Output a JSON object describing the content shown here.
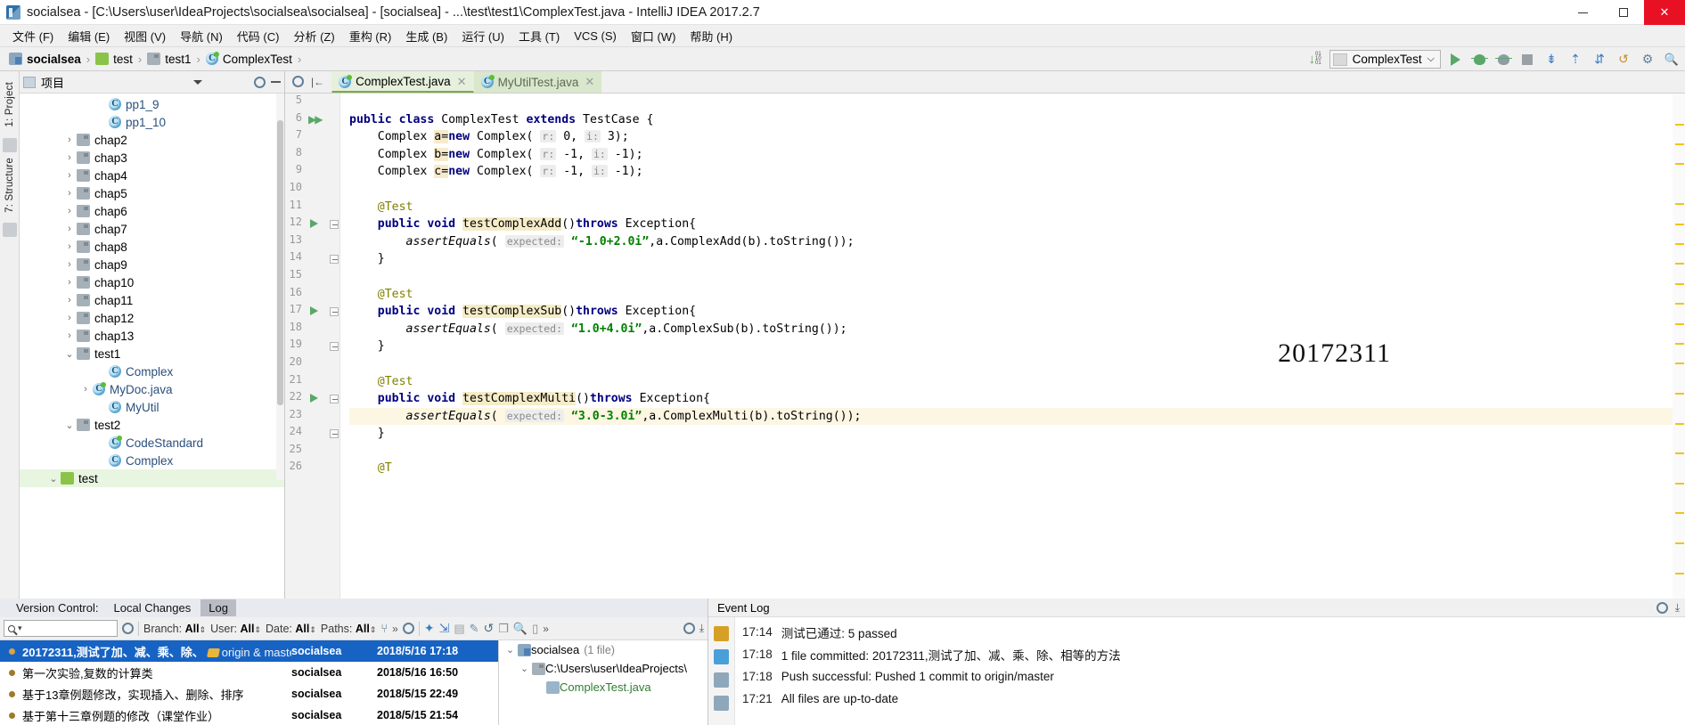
{
  "window": {
    "title": "socialsea - [C:\\Users\\user\\IdeaProjects\\socialsea\\socialsea] - [socialsea] - ...\\test\\test1\\ComplexTest.java - IntelliJ IDEA 2017.2.7",
    "app_icon": "intellij-idea-icon",
    "controls": {
      "minimize": "—",
      "maximize": "☐",
      "close": "✕"
    }
  },
  "menubar": {
    "items": [
      "文件 (F)",
      "编辑 (E)",
      "视图 (V)",
      "导航 (N)",
      "代码 (C)",
      "分析 (Z)",
      "重构 (R)",
      "生成 (B)",
      "运行 (U)",
      "工具 (T)",
      "VCS (S)",
      "窗口 (W)",
      "帮助 (H)"
    ]
  },
  "navbar": {
    "breadcrumbs": [
      {
        "label": "socialsea",
        "icon": "module-icon"
      },
      {
        "label": "test",
        "icon": "folder-green-icon"
      },
      {
        "label": "test1",
        "icon": "folder-gray-icon"
      },
      {
        "label": "ComplexTest",
        "icon": "java-class-icon"
      }
    ],
    "separator": "›",
    "run_config": {
      "name": "ComplexTest",
      "dropdown": "⌵"
    },
    "update_badge": "01\n10\n01",
    "buttons": [
      "run-button",
      "debug-button",
      "run-coverage-button",
      "stop-button",
      "vcs-update-button",
      "vcs-commit-button",
      "vcs-compare-button",
      "undo-button",
      "settings-button",
      "search-everywhere-button"
    ]
  },
  "left_rail": {
    "tabs": [
      "1: Project",
      "7: Structure"
    ],
    "bottom_icon": "favorites-icon"
  },
  "project_panel": {
    "title": "项目",
    "toolbar": [
      "collapse-all-icon",
      "settings-gear-icon",
      "hide-icon"
    ],
    "tree": [
      {
        "label": "pp1_9",
        "indent": 4,
        "arrow": "",
        "icon": "java-class-icon",
        "type": "class"
      },
      {
        "label": "pp1_10",
        "indent": 4,
        "arrow": "",
        "icon": "java-class-icon",
        "type": "class"
      },
      {
        "label": "chap2",
        "indent": 2,
        "arrow": "›",
        "icon": "folder-gray-icon",
        "type": "folder"
      },
      {
        "label": "chap3",
        "indent": 2,
        "arrow": "›",
        "icon": "folder-gray-icon",
        "type": "folder"
      },
      {
        "label": "chap4",
        "indent": 2,
        "arrow": "›",
        "icon": "folder-gray-icon",
        "type": "folder"
      },
      {
        "label": "chap5",
        "indent": 2,
        "arrow": "›",
        "icon": "folder-gray-icon",
        "type": "folder"
      },
      {
        "label": "chap6",
        "indent": 2,
        "arrow": "›",
        "icon": "folder-gray-icon",
        "type": "folder"
      },
      {
        "label": "chap7",
        "indent": 2,
        "arrow": "›",
        "icon": "folder-gray-icon",
        "type": "folder"
      },
      {
        "label": "chap8",
        "indent": 2,
        "arrow": "›",
        "icon": "folder-gray-icon",
        "type": "folder"
      },
      {
        "label": "chap9",
        "indent": 2,
        "arrow": "›",
        "icon": "folder-gray-icon",
        "type": "folder"
      },
      {
        "label": "chap10",
        "indent": 2,
        "arrow": "›",
        "icon": "folder-gray-icon",
        "type": "folder"
      },
      {
        "label": "chap11",
        "indent": 2,
        "arrow": "›",
        "icon": "folder-gray-icon",
        "type": "folder"
      },
      {
        "label": "chap12",
        "indent": 2,
        "arrow": "›",
        "icon": "folder-gray-icon",
        "type": "folder"
      },
      {
        "label": "chap13",
        "indent": 2,
        "arrow": "›",
        "icon": "folder-gray-icon",
        "type": "folder"
      },
      {
        "label": "test1",
        "indent": 2,
        "arrow": "⌄",
        "icon": "folder-gray-icon",
        "type": "folder"
      },
      {
        "label": "Complex",
        "indent": 4,
        "arrow": "",
        "icon": "java-class-icon",
        "type": "class"
      },
      {
        "label": "MyDoc.java",
        "indent": 3,
        "arrow": "›",
        "icon": "java-file-icon",
        "type": "class-run"
      },
      {
        "label": "MyUtil",
        "indent": 4,
        "arrow": "",
        "icon": "java-class-icon",
        "type": "class"
      },
      {
        "label": "test2",
        "indent": 2,
        "arrow": "⌄",
        "icon": "folder-gray-icon",
        "type": "folder"
      },
      {
        "label": "CodeStandard",
        "indent": 4,
        "arrow": "",
        "icon": "java-class-icon",
        "type": "class-run"
      },
      {
        "label": "Complex",
        "indent": 4,
        "arrow": "",
        "icon": "java-class-icon",
        "type": "class"
      },
      {
        "label": "test",
        "indent": 1,
        "arrow": "⌄",
        "icon": "folder-green-icon",
        "type": "folder",
        "selected": true
      }
    ]
  },
  "editor": {
    "tabs": [
      {
        "label": "ComplexTest.java",
        "icon": "java-class-icon",
        "active": true,
        "close": "✕"
      },
      {
        "label": "MyUtilTest.java",
        "icon": "java-class-icon",
        "active": false,
        "close": "✕"
      }
    ],
    "watermark": "20172311",
    "breadcrumb": [
      "ComplexTest",
      "testComplexMulti()"
    ],
    "breadcrumb_separator": "›",
    "lines": [
      {
        "num": "5",
        "segments": []
      },
      {
        "num": "6",
        "gutter": "run-all-icon",
        "segments": [
          {
            "t": "public ",
            "c": "kw"
          },
          {
            "t": "class ",
            "c": "kw"
          },
          {
            "t": "ComplexTest "
          },
          {
            "t": "extends ",
            "c": "kw"
          },
          {
            "t": "TestCase {"
          }
        ]
      },
      {
        "num": "7",
        "segments": [
          {
            "t": "    Complex "
          },
          {
            "t": "a",
            "c": "varhl"
          },
          {
            "t": "=",
            "c": "varhl"
          },
          {
            "t": "new",
            "c": "kw"
          },
          {
            "t": " Complex( "
          },
          {
            "t": "r:",
            "c": "hint"
          },
          {
            "t": " 0, "
          },
          {
            "t": "i:",
            "c": "hint"
          },
          {
            "t": " 3);"
          }
        ]
      },
      {
        "num": "8",
        "segments": [
          {
            "t": "    Complex "
          },
          {
            "t": "b",
            "c": "varhl"
          },
          {
            "t": "=",
            "c": "varhl"
          },
          {
            "t": "new",
            "c": "kw"
          },
          {
            "t": " Complex( "
          },
          {
            "t": "r:",
            "c": "hint"
          },
          {
            "t": " -1, "
          },
          {
            "t": "i:",
            "c": "hint"
          },
          {
            "t": " -1);"
          }
        ]
      },
      {
        "num": "9",
        "segments": [
          {
            "t": "    Complex "
          },
          {
            "t": "c",
            "c": "varhl"
          },
          {
            "t": "=",
            "c": "varhl"
          },
          {
            "t": "new",
            "c": "kw"
          },
          {
            "t": " Complex( "
          },
          {
            "t": "r:",
            "c": "hint"
          },
          {
            "t": " -1, "
          },
          {
            "t": "i:",
            "c": "hint"
          },
          {
            "t": " -1);"
          }
        ]
      },
      {
        "num": "10",
        "segments": []
      },
      {
        "num": "11",
        "segments": [
          {
            "t": "    @Test",
            "c": "anno"
          }
        ]
      },
      {
        "num": "12",
        "gutter": "run-method-icon",
        "fold": true,
        "segments": [
          {
            "t": "    public ",
            "c": "kw"
          },
          {
            "t": "void ",
            "c": "kw"
          },
          {
            "t": "testComplexAdd",
            "c": "mname"
          },
          {
            "t": "()"
          },
          {
            "t": "throws ",
            "c": "kw"
          },
          {
            "t": "Exception{"
          }
        ]
      },
      {
        "num": "13",
        "segments": [
          {
            "t": "        assertEquals",
            "c": "ital"
          },
          {
            "t": "( "
          },
          {
            "t": "expected:",
            "c": "hint"
          },
          {
            "t": " "
          },
          {
            "t": "“-1.0+2.0i”",
            "c": "str"
          },
          {
            "t": ",a.ComplexAdd(b).toString());"
          }
        ]
      },
      {
        "num": "14",
        "fold": true,
        "segments": [
          {
            "t": "    }"
          }
        ]
      },
      {
        "num": "15",
        "segments": []
      },
      {
        "num": "16",
        "segments": [
          {
            "t": "    @Test",
            "c": "anno"
          }
        ]
      },
      {
        "num": "17",
        "gutter": "run-method-icon",
        "fold": true,
        "segments": [
          {
            "t": "    public ",
            "c": "kw"
          },
          {
            "t": "void ",
            "c": "kw"
          },
          {
            "t": "testComplexSub",
            "c": "mname"
          },
          {
            "t": "()"
          },
          {
            "t": "throws ",
            "c": "kw"
          },
          {
            "t": "Exception{"
          }
        ]
      },
      {
        "num": "18",
        "segments": [
          {
            "t": "        assertEquals",
            "c": "ital"
          },
          {
            "t": "( "
          },
          {
            "t": "expected:",
            "c": "hint"
          },
          {
            "t": " "
          },
          {
            "t": "“1.0+4.0i”",
            "c": "str"
          },
          {
            "t": ",a.ComplexSub(b).toString());"
          }
        ]
      },
      {
        "num": "19",
        "fold": true,
        "segments": [
          {
            "t": "    }"
          }
        ]
      },
      {
        "num": "20",
        "segments": []
      },
      {
        "num": "21",
        "segments": [
          {
            "t": "    @Test",
            "c": "anno"
          }
        ]
      },
      {
        "num": "22",
        "gutter": "run-method-icon",
        "fold": true,
        "segments": [
          {
            "t": "    public ",
            "c": "kw"
          },
          {
            "t": "void ",
            "c": "kw"
          },
          {
            "t": "testComplexMulti",
            "c": "mname"
          },
          {
            "t": "()"
          },
          {
            "t": "throws ",
            "c": "kw"
          },
          {
            "t": "Exception{"
          }
        ]
      },
      {
        "num": "23",
        "highlight": true,
        "segments": [
          {
            "t": "        assertEquals",
            "c": "ital"
          },
          {
            "t": "( "
          },
          {
            "t": "expected:",
            "c": "hint"
          },
          {
            "t": " "
          },
          {
            "t": "“3.0-3.0i”",
            "c": "str"
          },
          {
            "t": ",a.ComplexMulti(b).toString());"
          }
        ]
      },
      {
        "num": "24",
        "fold": true,
        "segments": [
          {
            "t": "    }"
          }
        ]
      },
      {
        "num": "25",
        "segments": []
      },
      {
        "num": "26",
        "segments": [
          {
            "t": "    @T",
            "c": "anno"
          }
        ]
      }
    ]
  },
  "version_control": {
    "label": "Version Control:",
    "tabs": [
      {
        "label": "Local Changes",
        "active": false
      },
      {
        "label": "Log",
        "active": true
      }
    ],
    "search_placeholder": "",
    "search_icon": "search-icon",
    "filters": [
      {
        "label": "Branch:",
        "value": "All"
      },
      {
        "label": "User:",
        "value": "All"
      },
      {
        "label": "Date:",
        "value": "All"
      },
      {
        "label": "Paths:",
        "value": "All"
      }
    ],
    "overflow": "»",
    "toolbar_icons": [
      "settings-gear-icon",
      "collapse-icon",
      "refresh-icon",
      "intellisort-icon",
      "go-to-hash-icon",
      "show-diff-icon",
      "highlight-icon",
      "undo-icon",
      "copy-icon",
      "search-commits-icon",
      "show-details-icon",
      "more-icon"
    ],
    "commits": [
      {
        "message": "20172311,测试了加、减、乘、除、",
        "refs": "origin & master",
        "tag": true,
        "author": "socialsea",
        "date": "2018/5/16 17:18",
        "selected": true
      },
      {
        "message": "第一次实验,复数的计算类",
        "refs": "",
        "tag": false,
        "author": "socialsea",
        "date": "2018/5/16 16:50",
        "selected": false
      },
      {
        "message": "基于13章例题修改，实现插入、删除、排序",
        "refs": "",
        "tag": false,
        "author": "socialsea",
        "date": "2018/5/15 22:49",
        "selected": false
      },
      {
        "message": "基于第十三章例题的修改（课堂作业）",
        "refs": "",
        "tag": false,
        "author": "socialsea",
        "date": "2018/5/15 21:54",
        "selected": false
      }
    ],
    "changes_tree": [
      {
        "label": "socialsea",
        "count": "(1 file)",
        "indent": 0,
        "arrow": "⌄",
        "icon": "module-icon"
      },
      {
        "label": "C:\\Users\\user\\IdeaProjects\\",
        "count": "",
        "indent": 1,
        "arrow": "⌄",
        "icon": "folder-gray-icon"
      },
      {
        "label": "ComplexTest.java",
        "count": "",
        "indent": 2,
        "arrow": "",
        "icon": "java-file-icon"
      }
    ]
  },
  "event_log": {
    "title": "Event Log",
    "header_icons": [
      "settings-gear-icon",
      "hide-icon"
    ],
    "entries": [
      {
        "time": "17:14",
        "message": "测试已通过: 5 passed",
        "icon": "test-passed-icon"
      },
      {
        "time": "17:18",
        "message": "1 file committed: 20172311,测试了加、减、乘、除、相等的方法",
        "icon": "vcs-commit-icon"
      },
      {
        "time": "17:18",
        "message": "Push successful: Pushed 1 commit to origin/master",
        "icon": "vcs-push-icon"
      },
      {
        "time": "17:21",
        "message": "All files are up-to-date",
        "icon": "vcs-update-icon"
      }
    ]
  }
}
